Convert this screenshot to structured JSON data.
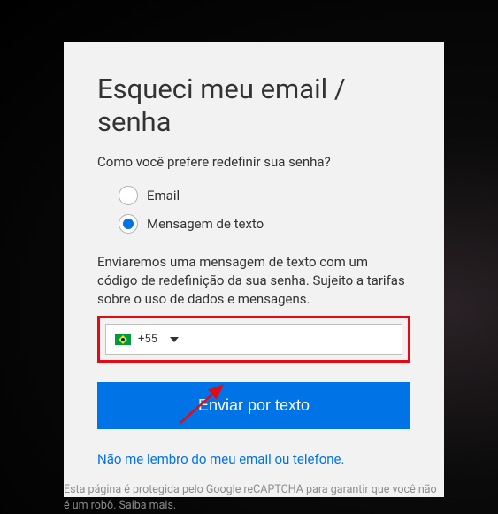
{
  "title": "Esqueci meu email / senha",
  "question": "Como você prefere redefinir sua senha?",
  "radio": {
    "email_label": "Email",
    "sms_label": "Mensagem de texto"
  },
  "instruction": "Enviaremos uma mensagem de texto com um código de redefinição da sua senha. Sujeito a tarifas sobre o uso de dados e mensagens.",
  "phone": {
    "dial_code": "+55",
    "value": ""
  },
  "submit_label": "Enviar por texto",
  "forgot_link": "Não me lembro do meu email ou telefone.",
  "footer": {
    "text_before": "Esta página é protegida pelo Google reCAPTCHA para garantir que você não é um robô. ",
    "link": "Saiba mais."
  }
}
